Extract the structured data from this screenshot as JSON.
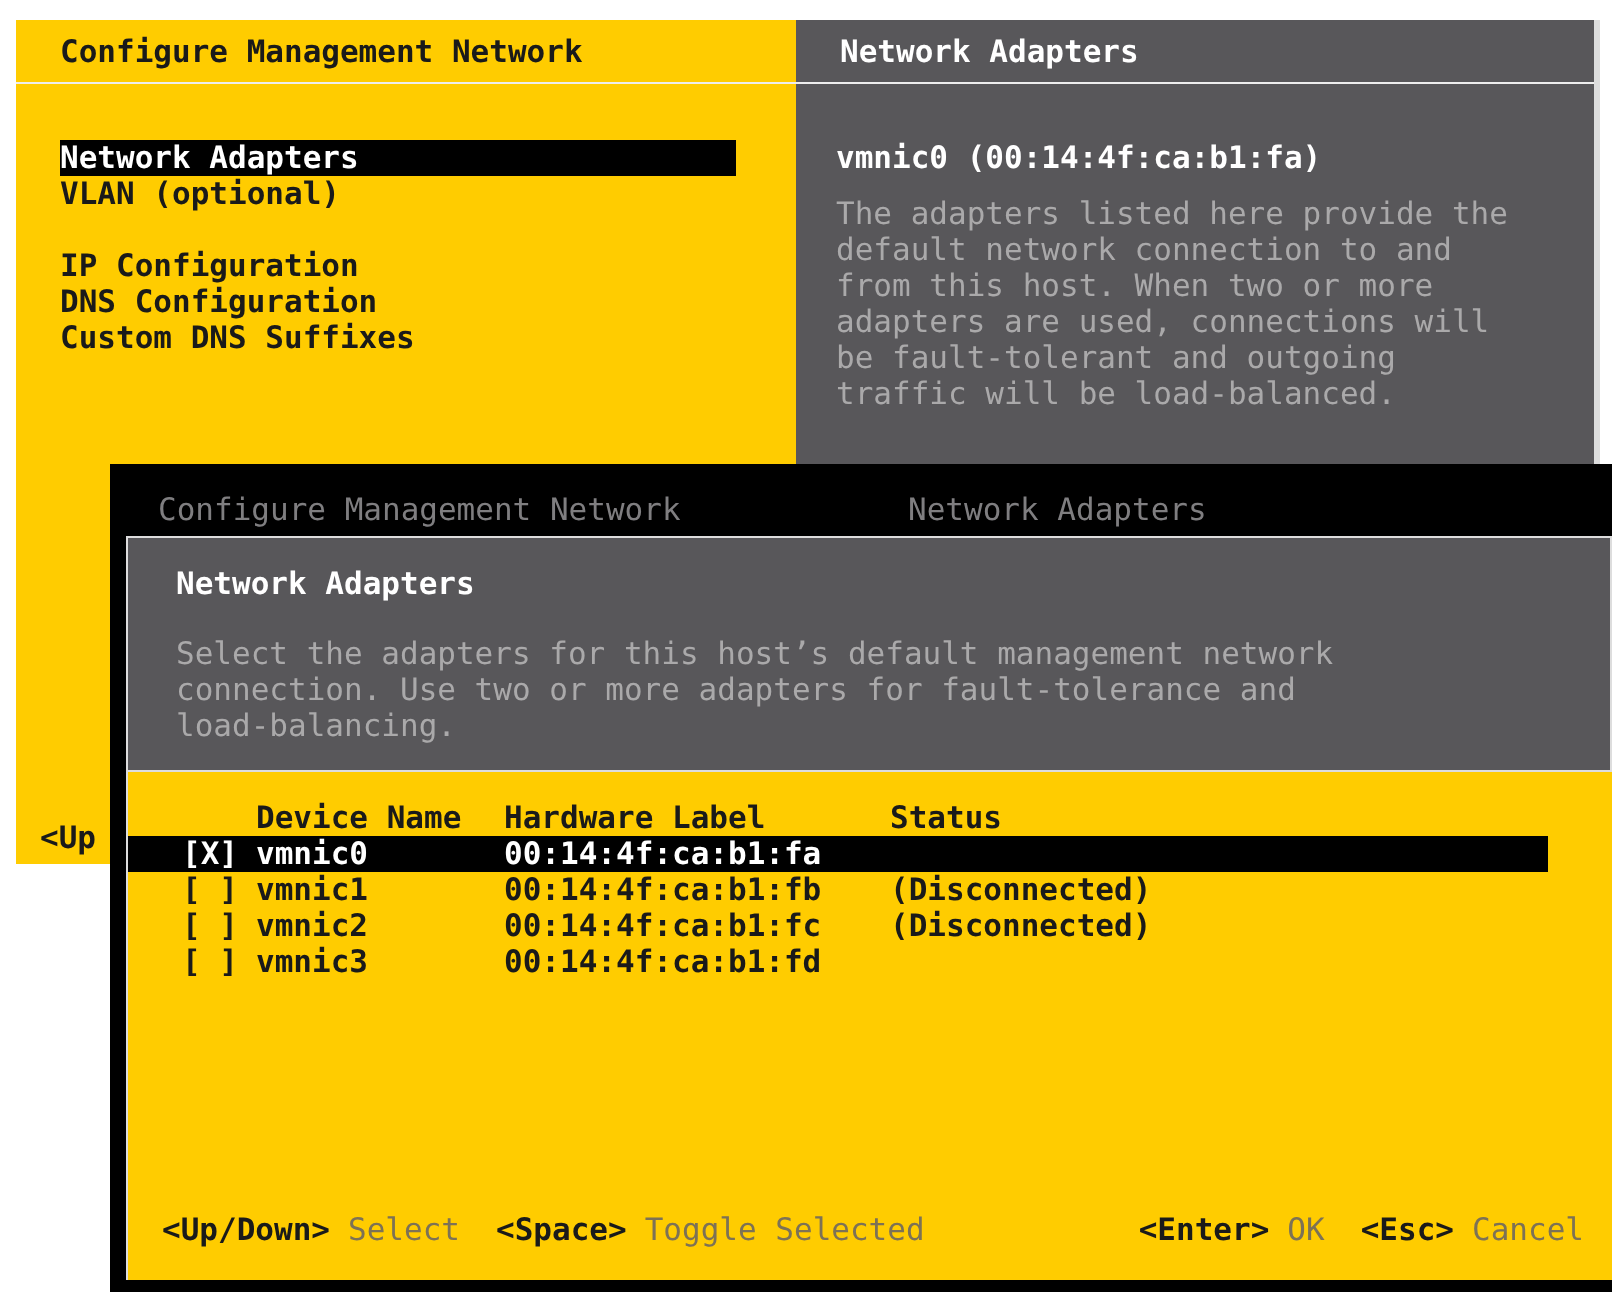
{
  "main_screen": {
    "left_title": "Configure Management Network",
    "right_title": "Network Adapters",
    "menu_groups": [
      {
        "items": [
          {
            "label": "Network Adapters",
            "selected": true
          },
          {
            "label": "VLAN (optional)",
            "selected": false
          }
        ]
      },
      {
        "items": [
          {
            "label": "IP Configuration",
            "selected": false
          },
          {
            "label": "DNS Configuration",
            "selected": false
          },
          {
            "label": "Custom DNS Suffixes",
            "selected": false
          }
        ]
      }
    ],
    "detail_heading": "vmnic0 (00:14:4f:ca:b1:fa)",
    "detail_text": "The adapters listed here provide the default network connection to and from this host. When two or more adapters are used, connections will be fault-tolerant and outgoing traffic will be load-balanced.",
    "footer_hint": "<Up"
  },
  "dialog": {
    "breadcrumb": [
      "Configure Management Network",
      "Network Adapters"
    ],
    "title": "Network Adapters",
    "description": "Select the adapters for this host’s default management network connection. Use two or more adapters for fault-tolerance and load-balancing.",
    "table": {
      "columns": [
        "Device Name",
        "Hardware Label",
        "Status"
      ],
      "rows": [
        {
          "checkbox": "[X]",
          "selected": true,
          "device": "vmnic0",
          "hardware_label": "00:14:4f:ca:b1:fa"
        },
        {
          "checkbox": "[ ]",
          "selected": false,
          "device": "vmnic1",
          "hardware_label": "00:14:4f:ca:b1:fb",
          "status": "(Disconnected)"
        },
        {
          "checkbox": "[ ]",
          "selected": false,
          "device": "vmnic2",
          "hardware_label": "00:14:4f:ca:b1:fc",
          "status": "(Disconnected)"
        },
        {
          "checkbox": "[ ]",
          "selected": false,
          "device": "vmnic3",
          "hardware_label": "00:14:4f:ca:b1:fd"
        }
      ]
    },
    "footer_left": [
      {
        "key": "<Up/Down>",
        "action": "Select"
      },
      {
        "key": "<Space>",
        "action": "Toggle Selected"
      }
    ],
    "footer_right": [
      {
        "key": "<Enter>",
        "action": "OK"
      },
      {
        "key": "<Esc>",
        "action": "Cancel"
      }
    ]
  }
}
